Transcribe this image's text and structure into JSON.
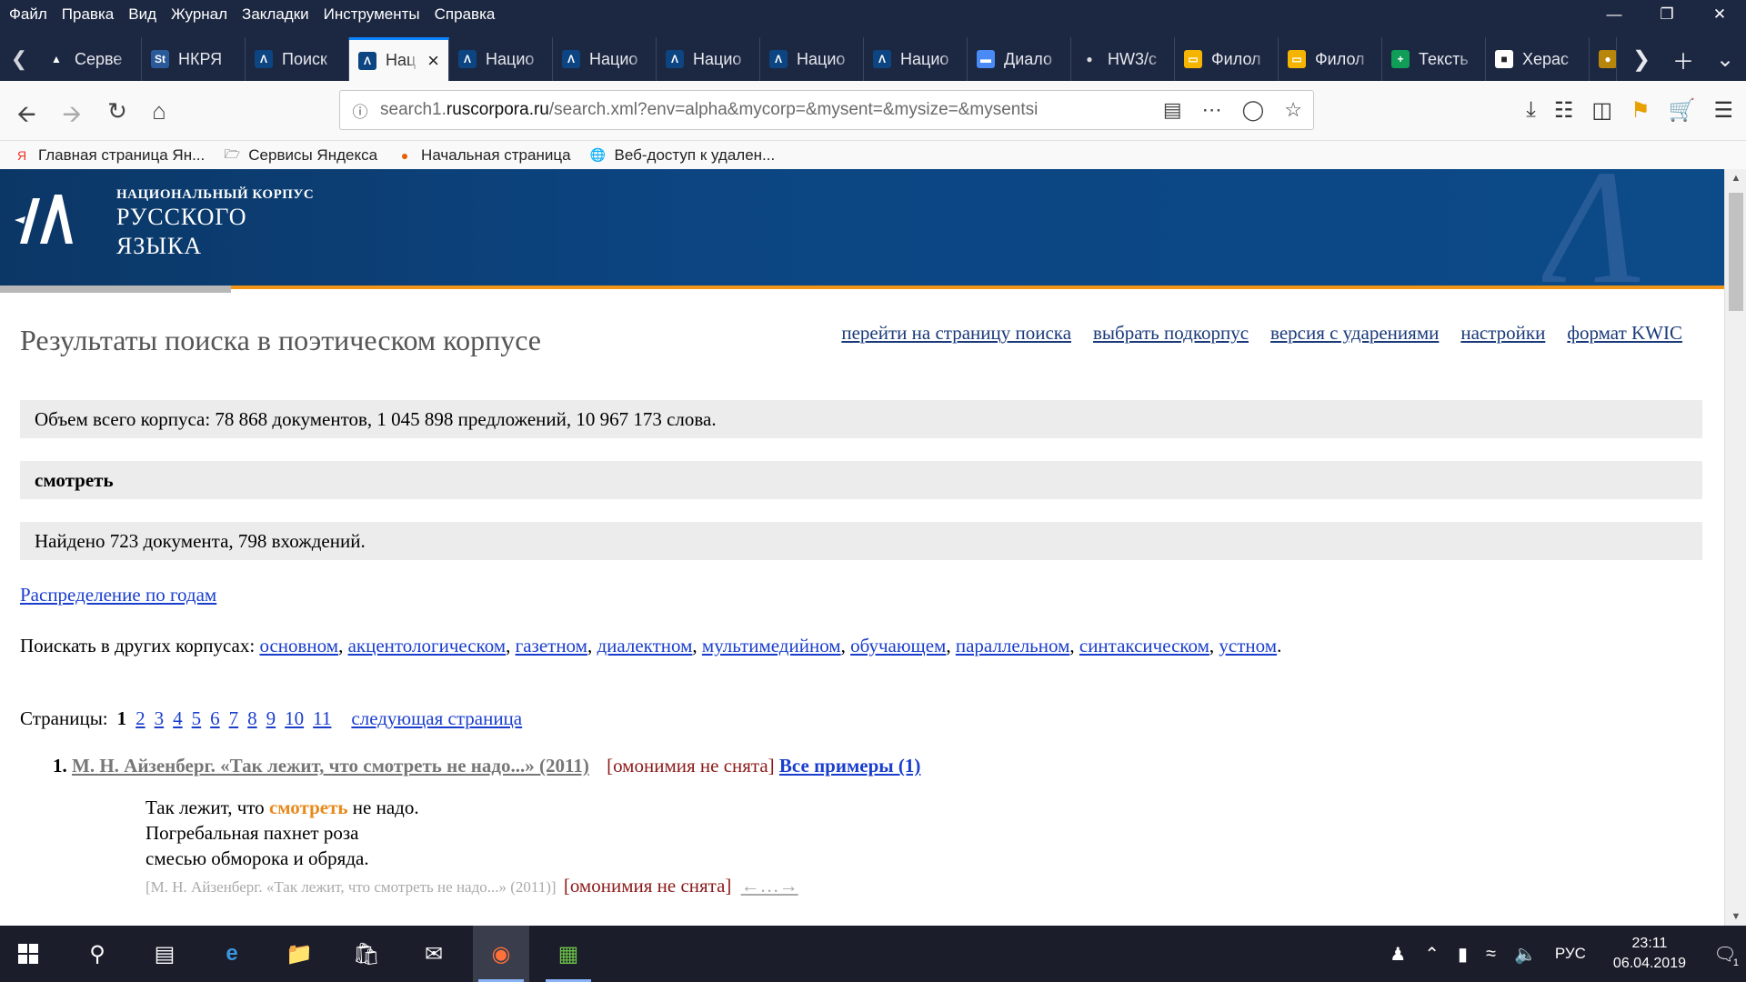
{
  "menubar": {
    "items": [
      "Файл",
      "Правка",
      "Вид",
      "Журнал",
      "Закладки",
      "Инструменты",
      "Справка"
    ]
  },
  "tabs": [
    {
      "label": "Серве",
      "icon": "warning-icon",
      "color": "#ffffff"
    },
    {
      "label": "НКРЯ",
      "icon": "st-icon",
      "color": "#2a5a9a"
    },
    {
      "label": "Поиск",
      "icon": "ruscorpora-icon",
      "color": "#0c4582"
    },
    {
      "label": "Нац",
      "icon": "ruscorpora-icon",
      "color": "#0c4582",
      "active": true
    },
    {
      "label": "Нацио",
      "icon": "ruscorpora-icon",
      "color": "#0c4582"
    },
    {
      "label": "Нацио",
      "icon": "ruscorpora-icon",
      "color": "#0c4582"
    },
    {
      "label": "Нацио",
      "icon": "ruscorpora-icon",
      "color": "#0c4582"
    },
    {
      "label": "Нацио",
      "icon": "ruscorpora-icon",
      "color": "#0c4582"
    },
    {
      "label": "Нацио",
      "icon": "ruscorpora-icon",
      "color": "#0c4582"
    },
    {
      "label": "Диало",
      "icon": "chat-icon",
      "color": "#4a8af4"
    },
    {
      "label": "HW3/c",
      "icon": "github-icon",
      "color": "#333333"
    },
    {
      "label": "Филол",
      "icon": "slides-icon",
      "color": "#f4b400"
    },
    {
      "label": "Филол",
      "icon": "slides-icon",
      "color": "#f4b400"
    },
    {
      "label": "Тексть",
      "icon": "sheets-icon",
      "color": "#0f9d58"
    },
    {
      "label": "Херас",
      "icon": "film-icon",
      "color": "#222222"
    }
  ],
  "url": {
    "prefix": "search1.",
    "domain": "ruscorpora.ru",
    "rest": "/search.xml?env=alpha&mycorp=&mysent=&mysize=&mysentsi"
  },
  "bookmarks": [
    {
      "label": "Главная страница Ян...",
      "icon": "yandex-icon"
    },
    {
      "label": "Сервисы Яндекса",
      "icon": "folder-icon"
    },
    {
      "label": "Начальная страница",
      "icon": "firefox-icon"
    },
    {
      "label": "Веб-доступ к удален...",
      "icon": "globe-icon"
    }
  ],
  "banner": {
    "line1": "НАЦИОНАЛЬНЫЙ КОРПУС",
    "line2": "РУССКОГО",
    "line3": "ЯЗЫКА"
  },
  "page": {
    "title": "Результаты поиска в поэтическом корпусе",
    "links": [
      "перейти на страницу поиска",
      "выбрать подкорпус",
      "версия с ударениями",
      "настройки",
      "формат KWIC"
    ],
    "corpus_size": "Объем всего корпуса: 78 868 документов, 1 045 898 предложений, 10 967 173 слова.",
    "query": "смотреть",
    "found": "Найдено 723 документа, 798 вхождений.",
    "distribution": "Распределение по годам",
    "other_label": "Поискать в других корпусах:",
    "other_corpora": [
      "основном",
      "акцентологическом",
      "газетном",
      "диалектном",
      "мультимедийном",
      "обучающем",
      "параллельном",
      "синтаксическом",
      "устном"
    ],
    "pages_label": "Страницы:",
    "current_page": "1",
    "page_numbers": [
      "2",
      "3",
      "4",
      "5",
      "6",
      "7",
      "8",
      "9",
      "10",
      "11"
    ],
    "next_page": "следующая страница"
  },
  "result": {
    "number": "1.",
    "source": "М. Н. Айзенберг. «Так лежит, что смотреть не надо...» (2011)",
    "homonymy": "[омонимия не снята]",
    "all_examples": "Все примеры (1)",
    "line1_before": "Так лежит, что ",
    "line1_hl": "смотреть",
    "line1_after": " не надо.",
    "line2": "Погребальная пахнет роза",
    "line3": "смесью обморока и обряда.",
    "snippet_source": "[М. Н. Айзенберг. «Так лежит, что смотреть не надо...» (2011)]",
    "snippet_homonymy": "[омонимия не снята]",
    "context_link": "←…→"
  },
  "taskbar": {
    "lang": "РУС",
    "time": "23:11",
    "date": "06.04.2019",
    "notifications": "1"
  }
}
